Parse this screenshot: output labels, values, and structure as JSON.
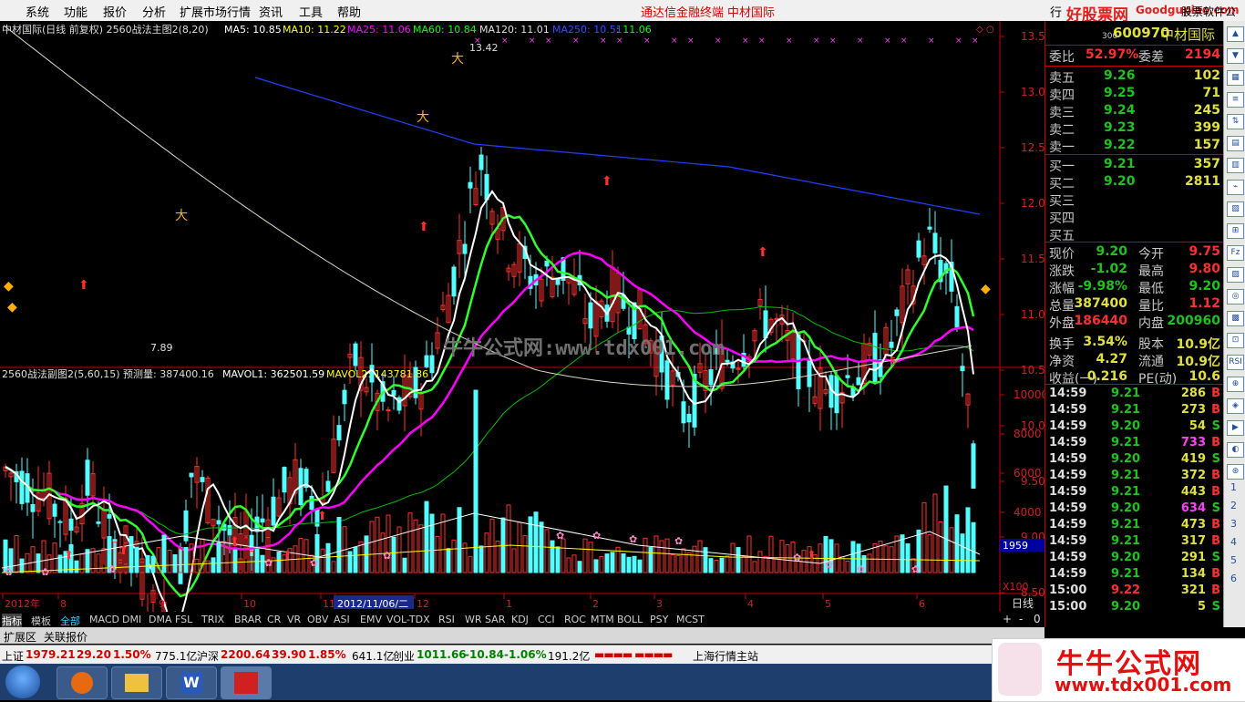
{
  "menu": {
    "items": [
      "系统",
      "功能",
      "报价",
      "分析",
      "扩展市场行情",
      "资讯",
      "工具",
      "帮助"
    ],
    "promo1": "通达信金融终端",
    "promo2": "中材国际",
    "right_tab": "行",
    "site_logo": "好股票网",
    "site_logo_url": "Goodgupiao.com",
    "right_text": "股票软件公式"
  },
  "chart": {
    "legend_name": "中材国际(日线 前复权) 2560战法主图2(8,20)",
    "ma5": "MA5: 10.85",
    "ma10": "MA10: 11.22",
    "ma25": "MA25: 11.06",
    "ma60": "MA60: 10.84",
    "ma120": "MA120: 11.01",
    "ma250": "MA250: 10.51",
    "ma_last": ": 11.06",
    "high_label": "13.42",
    "low_label": "7.89",
    "watermark": "牛牛公式网:www.tdx001.com",
    "price_ticks": [
      "13.50",
      "13.00",
      "12.50",
      "12.00",
      "11.50",
      "11.00",
      "10.50",
      "10.00",
      "9.50",
      "9.00",
      "8.50",
      "8.00"
    ],
    "vol_legend": "2560战法副图2(5,60,15) 预测量: 387400.16",
    "mavol1": "MAVOL1: 362501.59",
    "mavol2": "MAVOL2: 143781.86",
    "vol_ticks": [
      "10000",
      "8000",
      "6000",
      "4000"
    ],
    "vol_readout": "1959",
    "vol_unit": "X100",
    "date_labels": [
      "2012年",
      "8",
      "9",
      "10",
      "11",
      "2012/11/06/二",
      "12",
      "1",
      "2",
      "3",
      "4",
      "5",
      "6"
    ],
    "period": "日线"
  },
  "quote": {
    "code_small": "300",
    "code": "600970",
    "name": "中材国际",
    "weibi_label": "委比",
    "weibi": "52.97%",
    "weicha_label": "委差",
    "weicha": "2194",
    "asks": [
      {
        "label": "卖五",
        "price": "9.26",
        "vol": "102"
      },
      {
        "label": "卖四",
        "price": "9.25",
        "vol": "71"
      },
      {
        "label": "卖三",
        "price": "9.24",
        "vol": "245"
      },
      {
        "label": "卖二",
        "price": "9.23",
        "vol": "399"
      },
      {
        "label": "卖一",
        "price": "9.22",
        "vol": "157"
      }
    ],
    "bids": [
      {
        "label": "买一",
        "price": "9.21",
        "vol": "357"
      },
      {
        "label": "买二",
        "price": "9.20",
        "vol": "2811"
      },
      {
        "label": "买三",
        "price": "",
        "vol": ""
      },
      {
        "label": "买四",
        "price": "",
        "vol": ""
      },
      {
        "label": "买五",
        "price": "",
        "vol": ""
      }
    ],
    "stats": [
      {
        "l1": "现价",
        "v1": "9.20",
        "c1": "#1fc21f",
        "l2": "今开",
        "v2": "9.75",
        "c2": "#ff3030"
      },
      {
        "l1": "涨跌",
        "v1": "-1.02",
        "c1": "#1fc21f",
        "l2": "最高",
        "v2": "9.80",
        "c2": "#ff3030"
      },
      {
        "l1": "涨幅",
        "v1": "-9.98%",
        "c1": "#1fc21f",
        "l2": "最低",
        "v2": "9.20",
        "c2": "#1fc21f"
      },
      {
        "l1": "总量",
        "v1": "387400",
        "c1": "#e0e040",
        "l2": "量比",
        "v2": "1.12",
        "c2": "#ff3030"
      },
      {
        "l1": "外盘",
        "v1": "186440",
        "c1": "#ff3030",
        "l2": "内盘",
        "v2": "200960",
        "c2": "#1fc21f"
      },
      {
        "l1": "换手",
        "v1": "3.54%",
        "c1": "#e0e040",
        "l2": "股本",
        "v2": "10.9亿",
        "c2": "#e0e040"
      },
      {
        "l1": "净资",
        "v1": "4.27",
        "c1": "#e0e040",
        "l2": "流通",
        "v2": "10.9亿",
        "c2": "#e0e040"
      },
      {
        "l1": "收益(一)",
        "v1": "0.216",
        "c1": "#e0e040",
        "l2": "PE(动)",
        "v2": "10.6",
        "c2": "#e0e040"
      }
    ],
    "ticks": [
      {
        "t": "14:59",
        "p": "9.21",
        "v": "286",
        "bs": "B"
      },
      {
        "t": "14:59",
        "p": "9.21",
        "v": "273",
        "bs": "B"
      },
      {
        "t": "14:59",
        "p": "9.20",
        "v": "54",
        "bs": "S"
      },
      {
        "t": "14:59",
        "p": "9.21",
        "v": "733",
        "bs": "B"
      },
      {
        "t": "14:59",
        "p": "9.20",
        "v": "419",
        "bs": "S"
      },
      {
        "t": "14:59",
        "p": "9.21",
        "v": "372",
        "bs": "B"
      },
      {
        "t": "14:59",
        "p": "9.21",
        "v": "443",
        "bs": "B"
      },
      {
        "t": "14:59",
        "p": "9.20",
        "v": "634",
        "bs": "S"
      },
      {
        "t": "14:59",
        "p": "9.21",
        "v": "473",
        "bs": "B"
      },
      {
        "t": "14:59",
        "p": "9.21",
        "v": "317",
        "bs": "B"
      },
      {
        "t": "14:59",
        "p": "9.20",
        "v": "291",
        "bs": "S"
      },
      {
        "t": "14:59",
        "p": "9.21",
        "v": "134",
        "bs": "B"
      },
      {
        "t": "15:00",
        "p": "9.22",
        "v": "321",
        "bs": "B"
      },
      {
        "t": "15:00",
        "p": "9.20",
        "v": "5",
        "bs": "S"
      }
    ]
  },
  "tabs": [
    "指标",
    "模板",
    "全部",
    "MACD",
    "DMI",
    "DMA",
    "FSL",
    "TRIX",
    "BRAR",
    "CR",
    "VR",
    "OBV",
    "ASI",
    "EMV",
    "VOL-TDX",
    "RSI",
    "WR",
    "SAR",
    "KDJ",
    "CCI",
    "ROC",
    "MTM",
    "BOLL",
    "PSY",
    "MCST"
  ],
  "tabs2": [
    "扩展区",
    "关联报价"
  ],
  "scroll_controls": [
    "+",
    "-",
    "0"
  ],
  "status": {
    "sh_label": "上证",
    "sh_val": "1979.21",
    "sh_chg": "29.20",
    "sh_pct": "1.50%",
    "sh_amt": "775.1亿",
    "sz_label": "沪深",
    "sz_val": "2200.64",
    "sz_chg": "39.90",
    "sz_pct": "1.85%",
    "sz_amt": "641.1亿",
    "cy_label": "创业",
    "cy_val": "1011.66",
    "cy_chg": "-10.84",
    "cy_pct": "-1.06%",
    "cy_amt": "191.2亿",
    "station": "上海行情主站"
  },
  "banner": {
    "title": "牛牛公式网",
    "url": "www.tdx001.com"
  },
  "colors": {
    "up": "#ff3030",
    "down": "#54ffff",
    "ma5": "#ffffff",
    "ma10": "#ffff00",
    "ma25": "#ff00ff",
    "ma60": "#00ff00",
    "ma250": "#2040ff"
  }
}
